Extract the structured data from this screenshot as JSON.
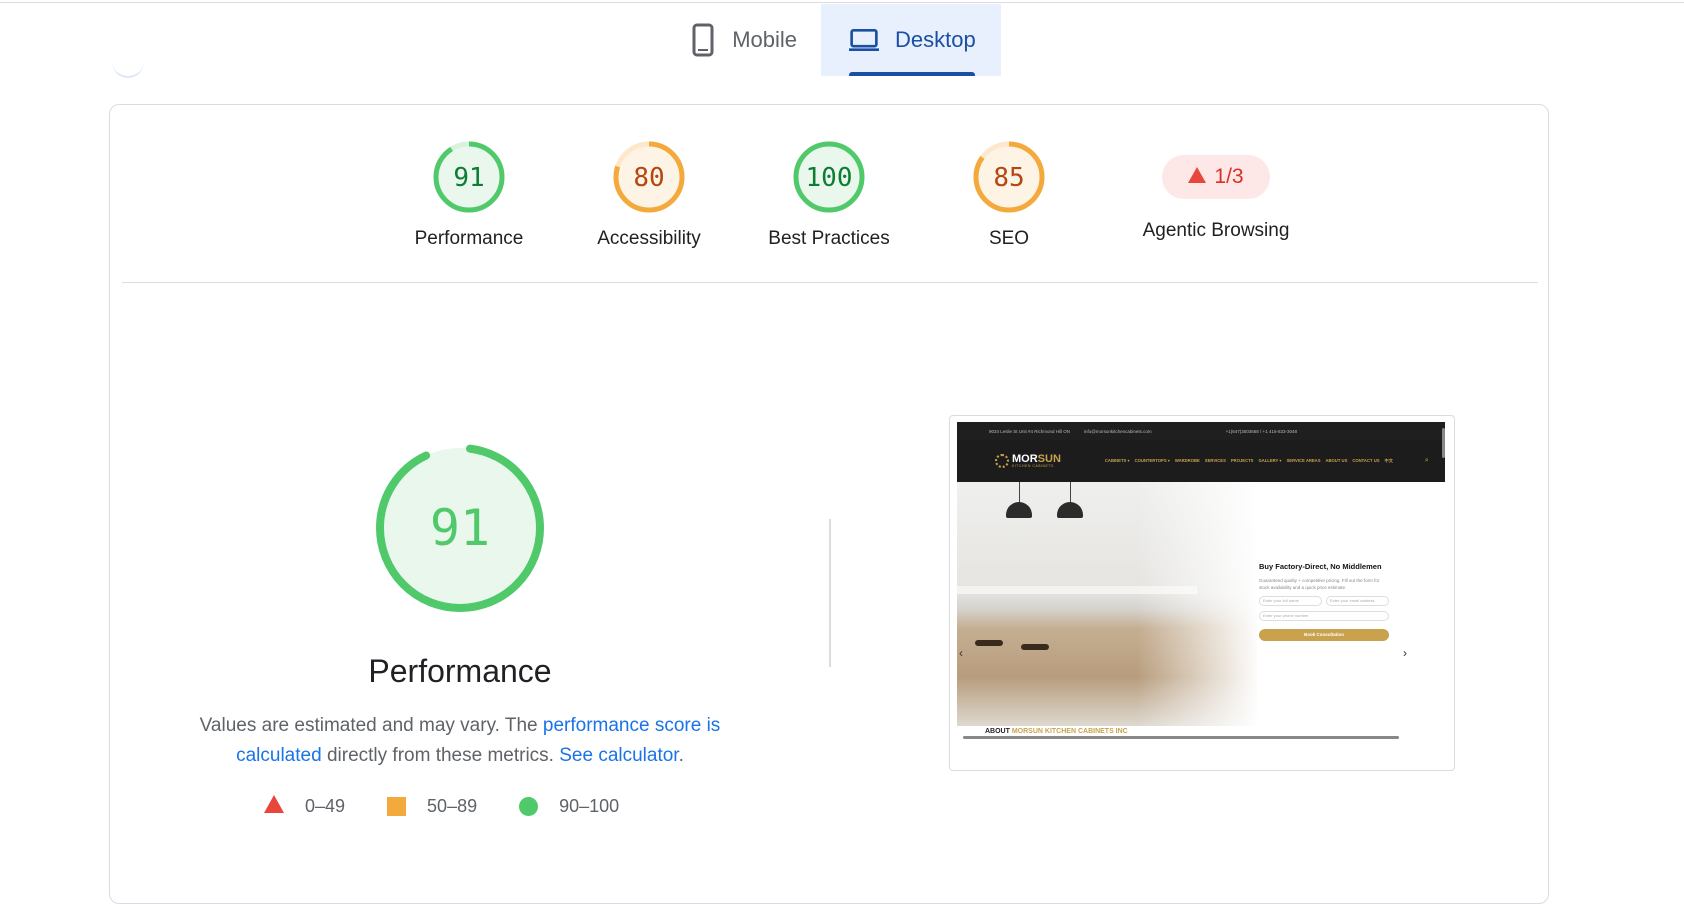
{
  "tabs": {
    "mobile": {
      "label": "Mobile",
      "icon": "phone-icon"
    },
    "desktop": {
      "label": "Desktop",
      "icon": "laptop-icon",
      "selected": true
    }
  },
  "categories": [
    {
      "name": "Performance",
      "score": "91",
      "status": "pass",
      "color": "#0c7d32"
    },
    {
      "name": "Accessibility",
      "score": "80",
      "status": "average",
      "color": "#b5460f"
    },
    {
      "name": "Best Practices",
      "score": "100",
      "status": "pass",
      "color": "#0c7d32"
    },
    {
      "name": "SEO",
      "score": "85",
      "status": "average",
      "color": "#b5460f"
    }
  ],
  "agentic": {
    "name": "Agentic Browsing",
    "score": "1/3",
    "icon": "warning-triangle-icon"
  },
  "performance": {
    "score": "91",
    "title": "Performance",
    "desc_prefix": "Values are estimated and may vary. The ",
    "link1": "performance score is calculated",
    "desc_middle": " directly from these metrics. ",
    "link2": "See calculator",
    "desc_suffix": "."
  },
  "legend": [
    {
      "range": "0–49",
      "shape": "triangle",
      "color": "#e8453c"
    },
    {
      "range": "50–89",
      "shape": "square",
      "color": "#f4a93d"
    },
    {
      "range": "90–100",
      "shape": "circle",
      "color": "#4fc96a"
    }
  ],
  "screenshot": {
    "topbar": [
      "9034 Leslie St Unit #4 Richmond Hill ON",
      "info@morsunkitchencabinets.com",
      "+1(647)3503668 / +1 416-833-3048"
    ],
    "logo_main": "MOR",
    "logo_accent": "SUN",
    "logo_sub": "KITCHEN CABINETS",
    "nav": [
      "CABINETS ▾",
      "COUNTERTOPS ▾",
      "WARDROBE",
      "SERVICES",
      "PROJECTS",
      "GALLERY ▾",
      "SERVICE AREAS",
      "ABOUT US",
      "CONTACT US",
      "中文"
    ],
    "form_title": "Buy Factory-Direct, No Middlemen",
    "form_sub": "Guaranteed quality + competitive pricing. Fill out the form for stock availability and a quick price estimate.",
    "name_placeholder": "Enter your full name",
    "email_placeholder": "Enter your email address",
    "phone_placeholder": "Enter your phone number",
    "button": "Book Consultation",
    "about_prefix": "ABOUT ",
    "about_accent": "MORSUN KITCHEN CABINETS INC"
  }
}
